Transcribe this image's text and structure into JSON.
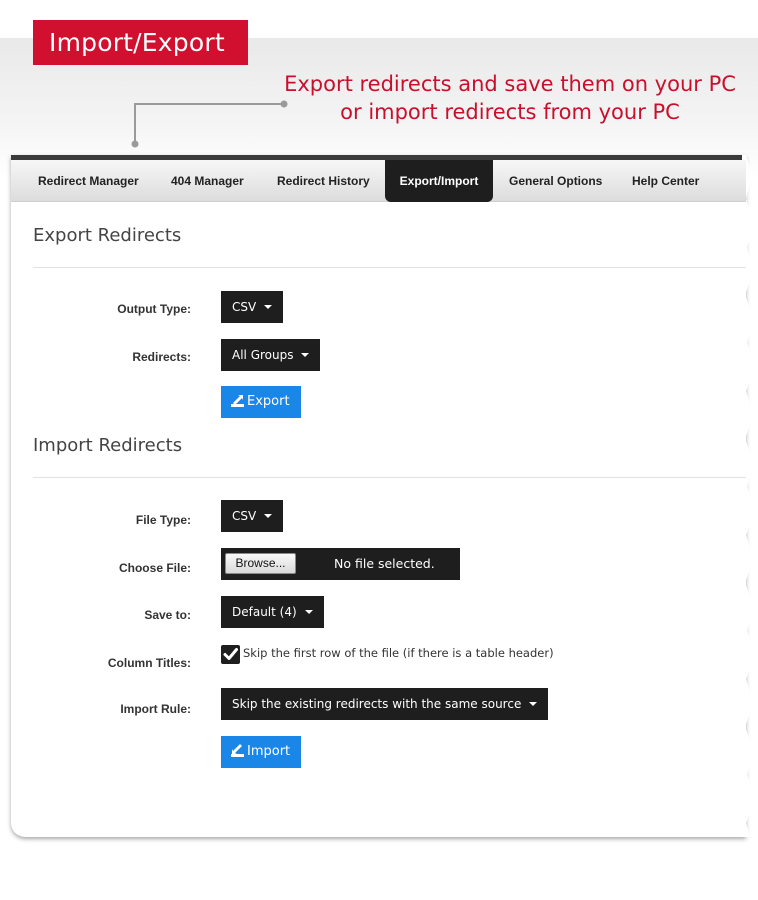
{
  "header": {
    "badge_title": "Import/Export",
    "tagline_line1": "Export redirects and save them on your PC",
    "tagline_line2": "or import redirects from your PC"
  },
  "tabs": [
    {
      "label": "Redirect Manager",
      "active": false
    },
    {
      "label": "404 Manager",
      "active": false
    },
    {
      "label": "Redirect History",
      "active": false
    },
    {
      "label": "Export/Import",
      "active": true
    },
    {
      "label": "General Options",
      "active": false
    },
    {
      "label": "Help Center",
      "active": false
    }
  ],
  "export_section": {
    "title": "Export Redirects",
    "output_type_label": "Output Type:",
    "output_type_value": "CSV",
    "redirects_label": "Redirects:",
    "redirects_value": "All Groups",
    "export_button": "Export"
  },
  "import_section": {
    "title": "Import Redirects",
    "file_type_label": "File Type:",
    "file_type_value": "CSV",
    "choose_file_label": "Choose File:",
    "browse_button": "Browse...",
    "file_status": "No file selected.",
    "save_to_label": "Save to:",
    "save_to_value": "Default (4)",
    "column_titles_label": "Column Titles:",
    "column_titles_checked": true,
    "column_titles_text": "Skip the first row of the file (if there is a table header)",
    "import_rule_label": "Import Rule:",
    "import_rule_value": "Skip the existing redirects with the same source",
    "import_button": "Import"
  },
  "colors": {
    "brand_red": "#d0102e",
    "button_blue": "#1a86e8",
    "dark_control": "#1e1e1e"
  }
}
